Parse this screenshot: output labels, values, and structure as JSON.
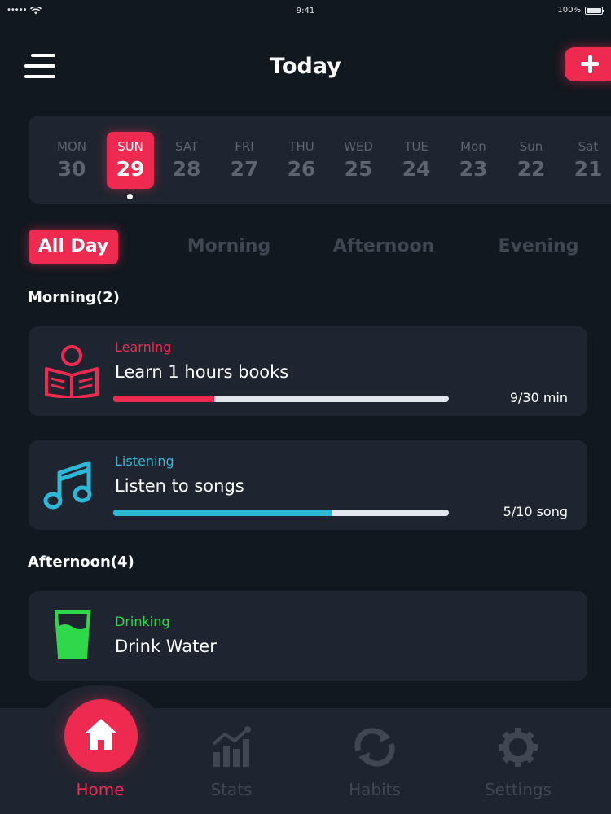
{
  "status_bar": {
    "signal": "•••••",
    "time": "9:41",
    "battery": "100%"
  },
  "header": {
    "title": "Today",
    "menu_icon": "hamburger-icon",
    "add_icon": "plus-icon"
  },
  "date_strip": {
    "days": [
      {
        "name": "MON",
        "num": "30"
      },
      {
        "name": "SUN",
        "num": "29",
        "active": true
      },
      {
        "name": "SAT",
        "num": "28"
      },
      {
        "name": "FRI",
        "num": "27"
      },
      {
        "name": "THU",
        "num": "26"
      },
      {
        "name": "WED",
        "num": "25"
      },
      {
        "name": "TUE",
        "num": "24"
      },
      {
        "name": "Mon",
        "num": "23"
      },
      {
        "name": "Sun",
        "num": "22"
      },
      {
        "name": "Sat",
        "num": "21"
      }
    ]
  },
  "tabs": [
    {
      "label": "All Day",
      "active": true
    },
    {
      "label": "Morning"
    },
    {
      "label": "Afternoon"
    },
    {
      "label": "Evening"
    }
  ],
  "sections": {
    "morning": "Morning(2)",
    "afternoon": "Afternoon(4)"
  },
  "habits": [
    {
      "category": "Learning",
      "name": "Learn 1 hours books",
      "count": "9/30 min",
      "progress": 0.3,
      "color": "#ef2a50",
      "icon": "reading-person-icon"
    },
    {
      "category": "Listening",
      "name": "Listen to songs",
      "count": "5/10 song",
      "progress": 0.65,
      "color": "#2eb8d8",
      "icon": "music-note-icon"
    },
    {
      "category": "Drinking",
      "name": "Drink Water",
      "color": "#2ed84a",
      "icon": "water-glass-icon"
    }
  ],
  "nav": [
    {
      "label": "Home",
      "icon": "home-icon",
      "active": true
    },
    {
      "label": "Stats",
      "icon": "stats-icon"
    },
    {
      "label": "Habits",
      "icon": "habits-cycle-icon"
    },
    {
      "label": "Settings",
      "icon": "gear-icon"
    }
  ],
  "colors": {
    "accent": "#ef2a50",
    "background": "#121820",
    "card": "#1f2530",
    "muted": "#3f4753"
  }
}
